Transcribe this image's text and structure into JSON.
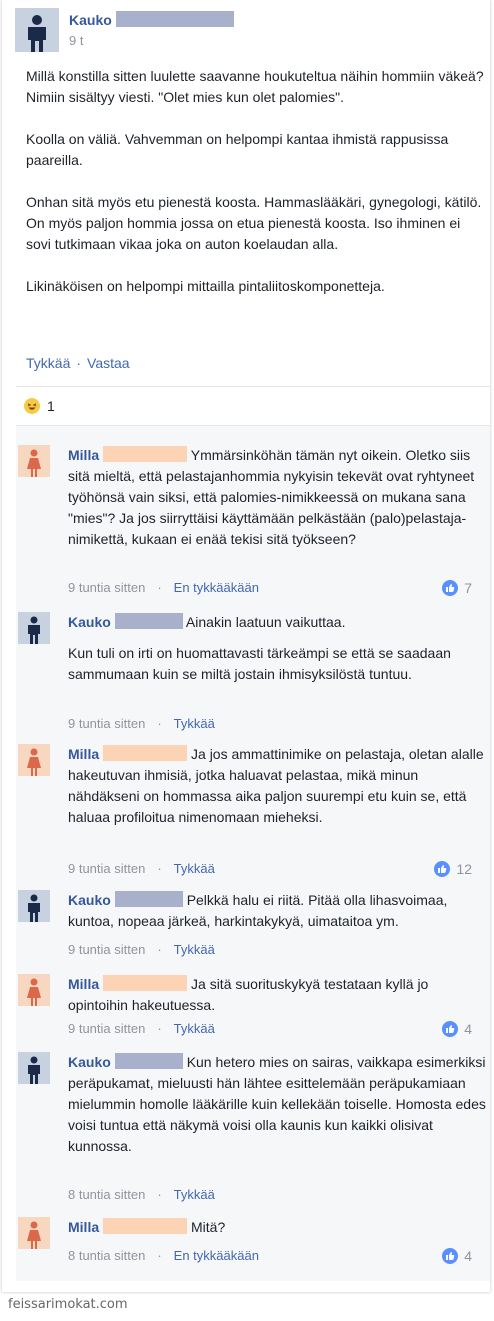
{
  "post": {
    "author": "Kauko",
    "time": "9 t",
    "paragraphs": [
      "Millä konstilla sitten luulette saavanne houkuteltua näihin hommiin väkeä? Nimiin sisältyy viesti. \"Olet mies kun olet palomies\".",
      "Koolla on väliä. Vahvemman on helpompi kantaa ihmistä rappusissa paareilla.",
      "Onhan sitä myös etu pienestä koosta. Hammaslääkäri, gynegologi, kätilö. On myös paljon hommia jossa on etua pienestä koosta. Iso ihminen ei sovi tutkimaan vikaa joka on auton koelaudan alla.",
      "Likinäköisen on helpompi mittailla pintaliitoskomponetteja."
    ],
    "like_label": "Tykkää",
    "reply_label": "Vastaa",
    "reaction_count": "1"
  },
  "comments": [
    {
      "author": "Milla",
      "text": "Ymmärsinköhän tämän nyt oikein. Oletko siis sitä mieltä, että pelastajanhommia nykyisin tekevät ovat ryhtyneet työhönsä vain siksi, että palomies-nimikkeessä on mukana sana \"mies\"? Ja jos siirryttäisi käyttämään pelkästään (palo)pelastaja-nimikettä, kukaan ei enää tekisi sitä työkseen?",
      "time": "9 tuntia sitten",
      "action": "En tykkääkään",
      "likes": "7"
    },
    {
      "author": "Kauko",
      "text": "Ainakin laatuun vaikuttaa.",
      "text2": "Kun tuli on irti on huomattavasti tärkeämpi se että se saadaan sammumaan kuin se miltä  jostain  ihmisyksilöstä tuntuu.",
      "time": "9 tuntia sitten",
      "action": "Tykkää",
      "likes": ""
    },
    {
      "author": "Milla",
      "text": "Ja jos ammattinimike on pelastaja, oletan alalle hakeutuvan ihmisiä, jotka haluavat pelastaa, mikä minun nähdäkseni on hommassa aika paljon suurempi etu kuin se, että haluaa profiloitua nimenomaan mieheksi.",
      "time": "9 tuntia sitten",
      "action": "Tykkää",
      "likes": "12"
    },
    {
      "author": "Kauko",
      "text": "Pelkkä halu ei riitä. Pitää olla lihasvoimaa, kuntoa, nopeaa järkeä, harkintakykyä, uimataitoa ym.",
      "time": "9 tuntia sitten",
      "action": "Tykkää",
      "likes": ""
    },
    {
      "author": "Milla",
      "text": "Ja sitä suorituskykyä testataan kyllä jo opintoihin hakeutuessa.",
      "time": "9 tuntia sitten",
      "action": "Tykkää",
      "likes": "4"
    },
    {
      "author": "Kauko",
      "text": "Kun hetero mies on sairas, vaikkapa esimerkiksi peräpukamat, mieluusti hän lähtee esittelemään peräpukamiaan mielummin homolle lääkärille kuin kellekään toiselle. Homosta edes voisi tuntua että näkymä voisi olla kaunis kun kaikki olisivat kunnossa.",
      "time": "8 tuntia sitten",
      "action": "Tykkää",
      "likes": ""
    },
    {
      "author": "Milla",
      "text": "Mitä?",
      "time": "8 tuntia sitten",
      "action": "En tykkääkään",
      "likes": "4"
    }
  ],
  "separator": "·",
  "watermark": "feissarimokat.com",
  "colors": {
    "link": "#4267b2",
    "name": "#365899",
    "meta": "#90949c",
    "male_censor": "#a9b0cc",
    "female_censor": "#fcd3b4",
    "like_blue": "#5890ff"
  }
}
